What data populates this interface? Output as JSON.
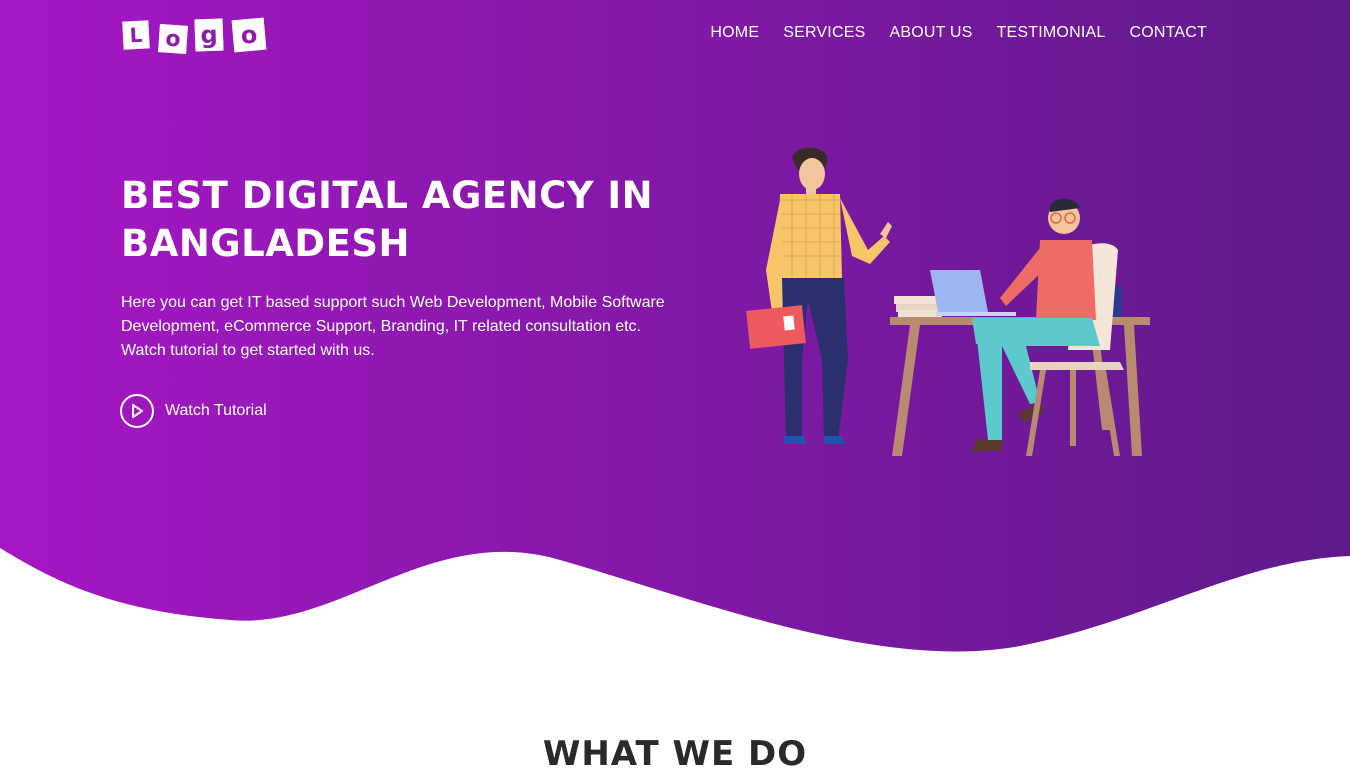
{
  "logo": {
    "letters": [
      "L",
      "o",
      "g",
      "o"
    ],
    "text": "Logo"
  },
  "nav": {
    "items": [
      {
        "label": "HOME"
      },
      {
        "label": "SERVICES"
      },
      {
        "label": "ABOUT US"
      },
      {
        "label": "TESTIMONIAL"
      },
      {
        "label": "CONTACT"
      }
    ]
  },
  "hero": {
    "title": "BEST DIGITAL AGENCY IN BANGLADESH",
    "description": "Here you can get IT based support such Web Development, Mobile Software Development, eCommerce Support, Branding, IT related consultation etc. Watch tutorial to get started with us.",
    "cta_label": "Watch Tutorial",
    "cta_icon": "play-circle-icon"
  },
  "section": {
    "title": "WHAT WE DO"
  },
  "colors": {
    "gradient_start": "#a617c4",
    "gradient_end": "#5e1a8a",
    "text_light": "#ffffff",
    "heading_dark": "#2a2a2a"
  }
}
